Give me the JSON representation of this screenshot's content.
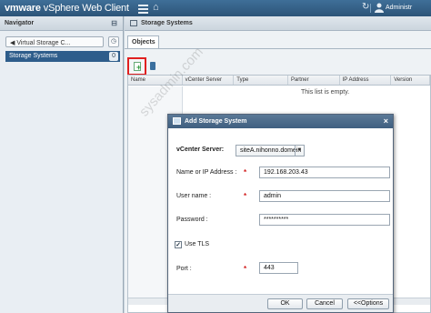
{
  "header": {
    "brand_vm": "vmware",
    "brand_rest": "vSphere Web Client",
    "user": "Administr"
  },
  "navigator": {
    "title": "Navigator",
    "breadcrumb": "◀ Virtual Storage C...",
    "items": [
      {
        "label": "Storage Systems",
        "count": "0"
      }
    ]
  },
  "main": {
    "title": "Storage Systems",
    "tabs": [
      {
        "label": "Objects"
      }
    ],
    "columns": [
      "Name",
      "vCenter Server",
      "Type",
      "Partner",
      "IP Address",
      "Version"
    ],
    "empty_text": "This list is empty."
  },
  "watermark": "sysadmin.com",
  "dialog": {
    "title": "Add Storage System",
    "vcenter_label": "vCenter Server:",
    "vcenter_value": "siteA.nihonno.domein",
    "ip_label": "Name or IP Address :",
    "ip_value": "192.168.203.43",
    "user_label": "User name :",
    "user_value": "admin",
    "password_label": "Password :",
    "password_value": "**********",
    "tls_label": "Use TLS",
    "tls_checked": true,
    "port_label": "Port :",
    "port_value": "443",
    "required_mark": "*",
    "ok": "OK",
    "cancel": "Cancel",
    "options": "<<Options"
  }
}
